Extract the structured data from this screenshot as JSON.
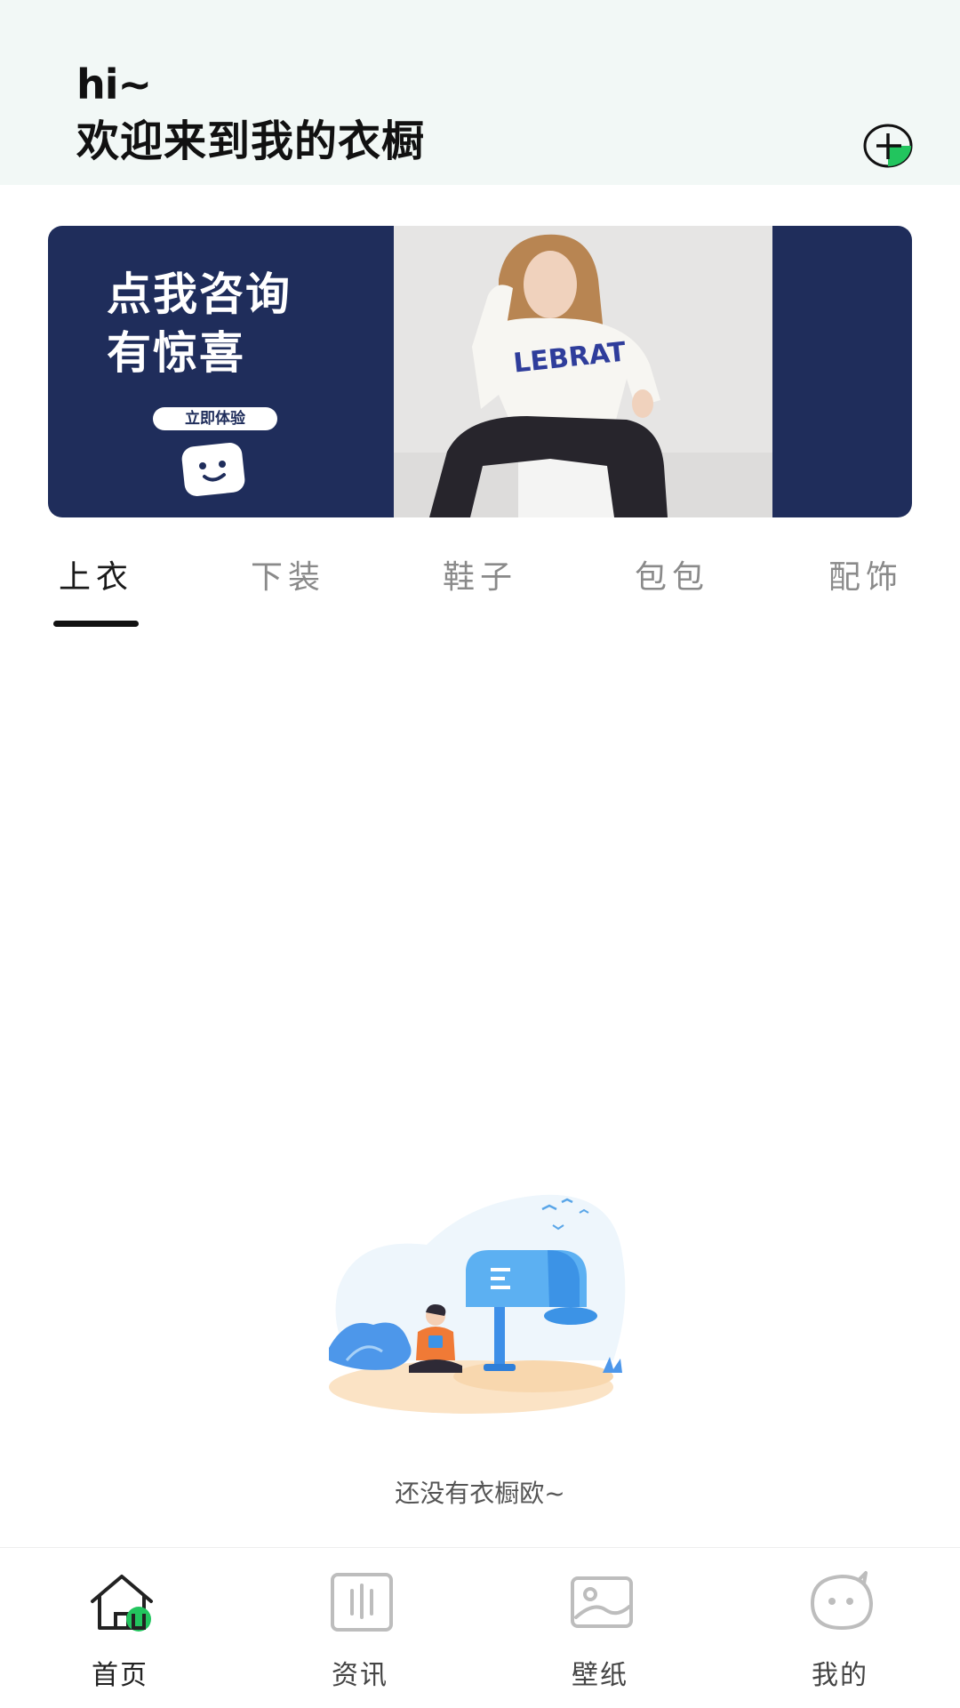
{
  "header": {
    "greeting": "hi~",
    "welcome": "欢迎来到我的衣橱",
    "add_icon": "add-circle-icon"
  },
  "banner": {
    "title_line1": "点我咨询",
    "title_line2": "有惊喜",
    "cta": "立即体验",
    "photo_text": "LEBRAT",
    "background_color": "#1f2d5b"
  },
  "tabs": [
    {
      "label": "上衣",
      "active": true
    },
    {
      "label": "下装",
      "active": false
    },
    {
      "label": "鞋子",
      "active": false
    },
    {
      "label": "包包",
      "active": false
    },
    {
      "label": "配饰",
      "active": false
    }
  ],
  "empty_state": {
    "text": "还没有衣橱欧~",
    "icon": "empty-mailbox-illustration"
  },
  "bottom_nav": [
    {
      "label": "首页",
      "icon": "home-icon",
      "active": true
    },
    {
      "label": "资讯",
      "icon": "news-icon",
      "active": false
    },
    {
      "label": "壁纸",
      "icon": "wallpaper-icon",
      "active": false
    },
    {
      "label": "我的",
      "icon": "profile-icon",
      "active": false
    }
  ],
  "colors": {
    "accent": "#22c55e",
    "header_bg": "#f2f8f6",
    "banner_bg": "#1f2d5b",
    "inactive_text": "#8a8a8a"
  }
}
